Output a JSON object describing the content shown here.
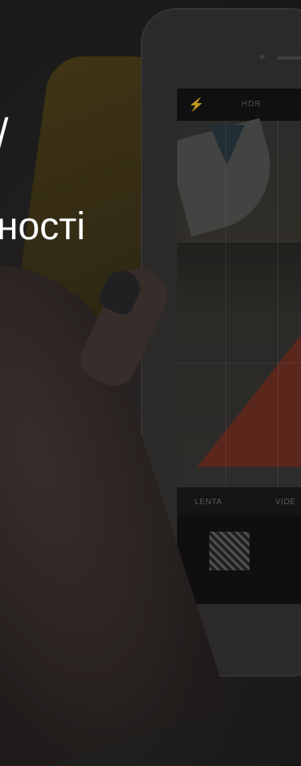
{
  "overlay_text": {
    "line1": "/",
    "line2": "ності"
  },
  "phone_ui": {
    "top_bar": {
      "flash_icon": "lightning-icon",
      "hdr_label": "HDR"
    },
    "modes": {
      "mode1": "LENTA",
      "mode2": "VIDE"
    }
  },
  "colors": {
    "hand": "#4a3d39",
    "red_triangle": "#7a3526",
    "yellow_shape": "#5a4a1a"
  }
}
